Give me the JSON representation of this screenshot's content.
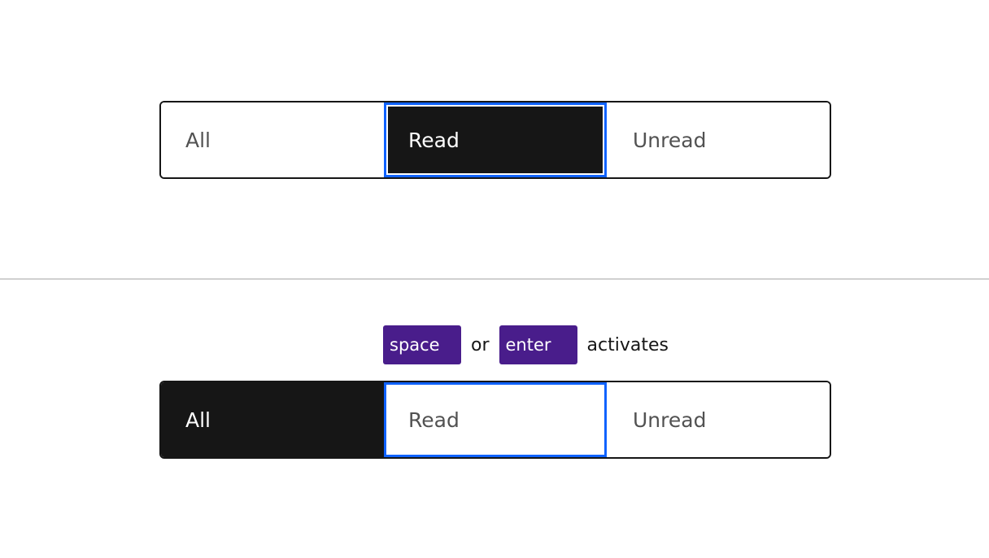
{
  "top_switcher": {
    "items": [
      {
        "label": "All"
      },
      {
        "label": "Read"
      },
      {
        "label": "Unread"
      }
    ],
    "selected": "Read",
    "focused": "Read"
  },
  "hint": {
    "key1": "space",
    "connector": "or",
    "key2": "enter",
    "suffix": "activates"
  },
  "bottom_switcher": {
    "items": [
      {
        "label": "All"
      },
      {
        "label": "Read"
      },
      {
        "label": "Unread"
      }
    ],
    "selected": "All",
    "focused": "Read"
  },
  "colors": {
    "selected_bg": "#161616",
    "focus_ring": "#0f62fe",
    "key_badge": "#491d8b",
    "divider": "#d0d0d0"
  }
}
